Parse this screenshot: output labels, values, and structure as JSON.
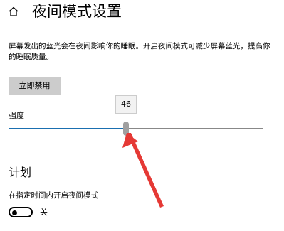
{
  "header": {
    "title": "夜间模式设置",
    "icon": "home-icon"
  },
  "description": "屏幕发出的蓝光会在夜间影响你的睡眠。开启夜间模式可减少屏幕蓝光，提高你的睡眠质量。",
  "disable_button": {
    "label": "立即禁用"
  },
  "strength": {
    "label": "强度",
    "value": "46",
    "fraction": 0.46,
    "fill_color": "#1a6fb0"
  },
  "annotation": {
    "color": "#e53935"
  },
  "schedule": {
    "heading": "计划",
    "label": "在指定时间内开启夜间模式",
    "toggle_state": "关"
  }
}
